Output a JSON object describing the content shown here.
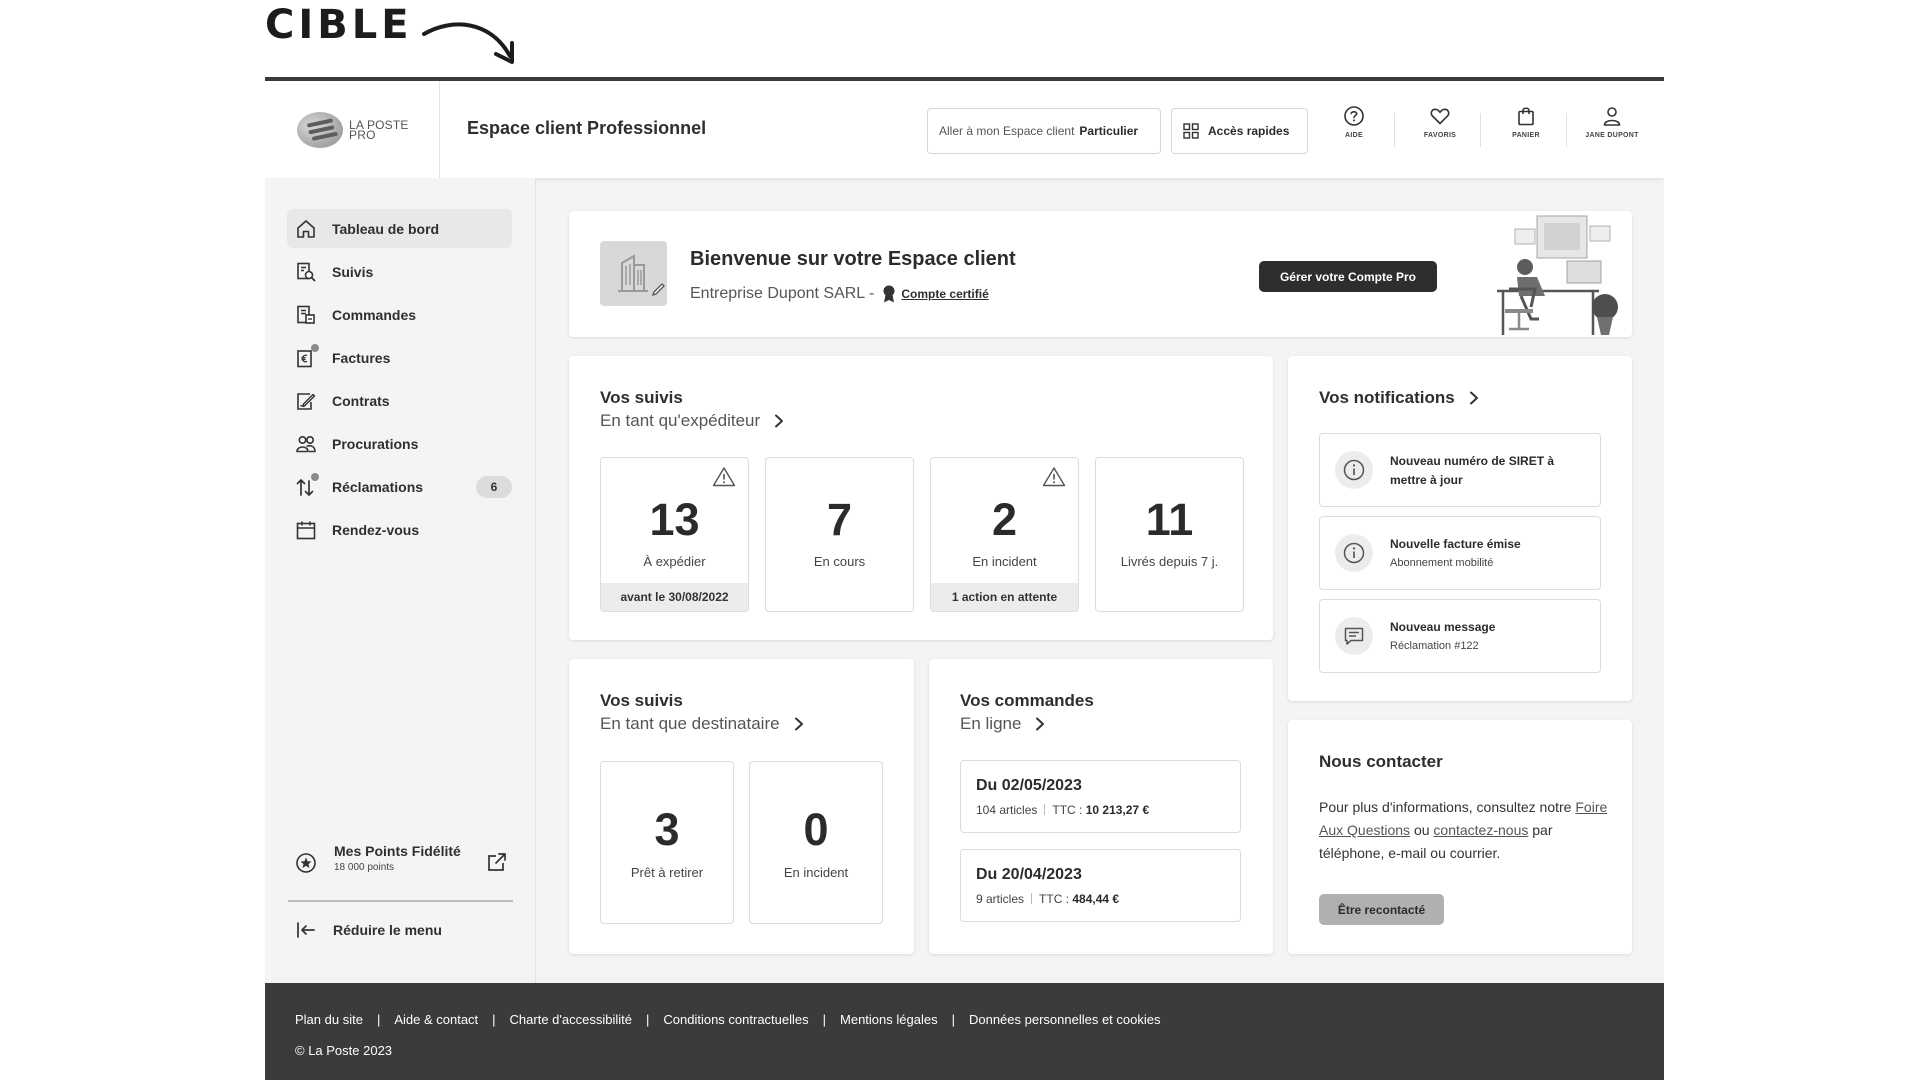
{
  "banner": {
    "label": "CIBLE"
  },
  "header": {
    "logo_line1": "LA POSTE",
    "logo_line2": "PRO",
    "title": "Espace client Professionnel",
    "switch_prefix": "Aller à mon Espace client",
    "switch_target": "Particulier",
    "quick_access": "Accès rapides",
    "icons": [
      {
        "label": "AIDE",
        "icon": "help-circle-icon"
      },
      {
        "label": "FAVORIS",
        "icon": "heart-icon"
      },
      {
        "label": "PANIER",
        "icon": "shopping-bag-icon"
      },
      {
        "label": "JANE DUPONT",
        "icon": "user-icon"
      }
    ]
  },
  "sidebar": {
    "items": [
      {
        "label": "Tableau de bord",
        "icon": "home-icon",
        "active": true
      },
      {
        "label": "Suivis",
        "icon": "tracking-icon"
      },
      {
        "label": "Commandes",
        "icon": "orders-icon"
      },
      {
        "label": "Factures",
        "icon": "invoice-icon"
      },
      {
        "label": "Contrats",
        "icon": "contract-icon"
      },
      {
        "label": "Procurations",
        "icon": "people-icon"
      },
      {
        "label": "Réclamations",
        "icon": "arrows-icon",
        "badge": "6"
      },
      {
        "label": "Rendez-vous",
        "icon": "calendar-icon"
      }
    ],
    "fidelite_title": "Mes Points Fidélité",
    "fidelite_points": "18 000 points",
    "reduce": "Réduire le menu"
  },
  "welcome": {
    "title": "Bienvenue sur votre Espace client",
    "company": "Entreprise Dupont SARL -",
    "certified": "Compte certifié",
    "manage_button": "Gérer votre Compte Pro"
  },
  "suivis_exp": {
    "title": "Vos suivis",
    "subtitle": "En tant qu'expéditeur",
    "stats": [
      {
        "value": "13",
        "label": "À expédier",
        "footer": "avant le 30/08/2022",
        "warning": true
      },
      {
        "value": "7",
        "label": "En cours"
      },
      {
        "value": "2",
        "label": "En incident",
        "footer": "1 action en attente",
        "warning": true
      },
      {
        "value": "11",
        "label": "Livrés depuis 7 j."
      }
    ]
  },
  "suivis_dest": {
    "title": "Vos suivis",
    "subtitle": "En tant que destinataire",
    "stats": [
      {
        "value": "3",
        "label": "Prêt à retirer"
      },
      {
        "value": "0",
        "label": "En incident"
      }
    ]
  },
  "commandes": {
    "title": "Vos commandes",
    "subtitle": "En ligne",
    "orders": [
      {
        "date": "Du 02/05/2023",
        "articles": "104 articles",
        "ttc_label": "TTC :",
        "ttc_value": "10 213,27 €"
      },
      {
        "date": "Du 20/04/2023",
        "articles": "9 articles",
        "ttc_label": "TTC :",
        "ttc_value": "484,44 €"
      }
    ]
  },
  "notifications": {
    "title": "Vos notifications",
    "items": [
      {
        "title": "Nouveau numéro de SIRET à mettre à jour",
        "subtitle": "",
        "icon": "info-icon"
      },
      {
        "title": "Nouvelle facture émise",
        "subtitle": "Abonnement mobilité",
        "icon": "info-icon"
      },
      {
        "title": "Nouveau message",
        "subtitle": "Réclamation #122",
        "icon": "message-icon"
      }
    ]
  },
  "contact": {
    "title": "Nous contacter",
    "text_1": "Pour plus d'informations, consultez notre",
    "faq_link": "Foire Aux Questions",
    "text_2": "ou",
    "contact_link": "contactez-nous",
    "text_3": "par téléphone, e-mail ou courrier.",
    "button": "Être recontacté"
  },
  "footer": {
    "links": [
      "Plan du site",
      "Aide & contact",
      "Charte d'accessibilité",
      "Conditions contractuelles",
      "Mentions légales",
      "Données personnelles et cookies"
    ],
    "separator": "|",
    "copyright": "© La Poste 2023"
  }
}
